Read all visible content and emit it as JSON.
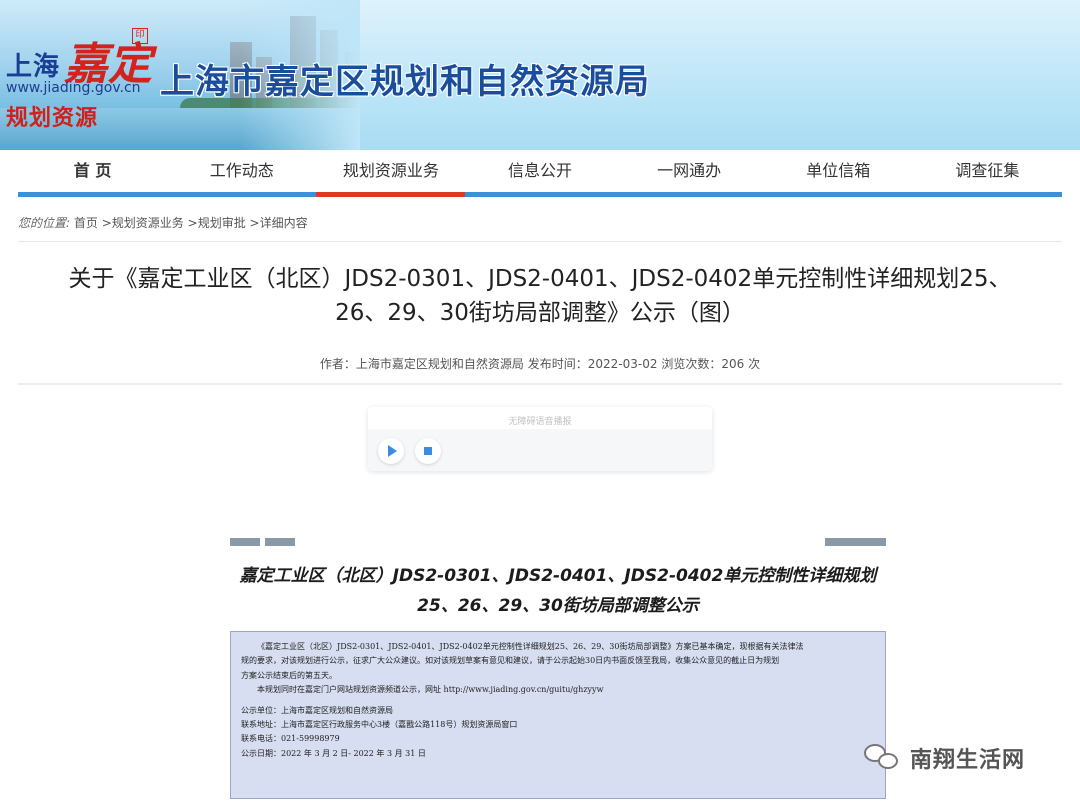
{
  "banner": {
    "logo_shanghai": "上海",
    "logo_jiading": "嘉定",
    "logo_stamp": "印",
    "logo_url": "www.jiading.gov.cn",
    "logo_subtitle": "规划资源",
    "site_title": "上海市嘉定区规划和自然资源局"
  },
  "nav": {
    "items": [
      "首 页",
      "工作动态",
      "规划资源业务",
      "信息公开",
      "一网通办",
      "单位信箱",
      "调查征集"
    ],
    "active_index": 2,
    "accent_color": "#3d8fd6",
    "active_color": "#e0372b"
  },
  "breadcrumb": {
    "lead": "您的位置:",
    "items": [
      "首页",
      "规划资源业务",
      "规划审批",
      "详细内容"
    ],
    "sep": ">"
  },
  "article": {
    "title_line1": "关于《嘉定工业区（北区）JDS2-0301、JDS2-0401、JDS2-0402单元控制性详细规划25、",
    "title_line2": "26、29、30街坊局部调整》公示（图）",
    "meta_author_label": "作者：",
    "meta_author": "上海市嘉定区规划和自然资源局",
    "meta_date_label": "发布时间：",
    "meta_date": "2022-03-02",
    "meta_views_label": "浏览次数：",
    "meta_views": "206",
    "meta_views_unit": "次"
  },
  "player": {
    "caption": "无障碍语音播报",
    "play_icon": "play-icon",
    "stop_icon": "stop-icon"
  },
  "notice": {
    "heading_line1": "嘉定工业区（北区）JDS2-0301、JDS2-0401、JDS2-0402单元控制性详细规划",
    "heading_line2": "25、26、29、30街坊局部调整公示",
    "para1_line1": "《嘉定工业区（北区）JDS2-0301、JDS2-0401、JDS2-0402单元控制性详细规划25、26、29、30街坊局部调整》方案已基本确定，现根据有关法律法",
    "para1_line2": "规的要求，对该规划进行公示，征求广大公众建议。如对该规划草案有意见和建议，请于公示起始30日内书面反馈至我局，收集公众意见的截止日为规划",
    "para1_line3": "方案公示结束后的第五天。",
    "para2": "本规划同时在嘉定门户网站规划资源频道公示，网址 http://www.jiading.gov.cn/guitu/ghzyyw",
    "unit_label": "公示单位：",
    "unit": "上海市嘉定区规划和自然资源局",
    "address_label": "联系地址：",
    "address": "上海市嘉定区行政服务中心3楼（嘉戬公路118号）规划资源局窗口",
    "phone_label": "联系电话：",
    "phone": "021-59998979",
    "date_label": "公示日期：",
    "date": "2022 年 3 月 2 日- 2022 年 3 月 31 日"
  },
  "watermark": {
    "icon": "wechat-icon",
    "text": "南翔生活网"
  }
}
